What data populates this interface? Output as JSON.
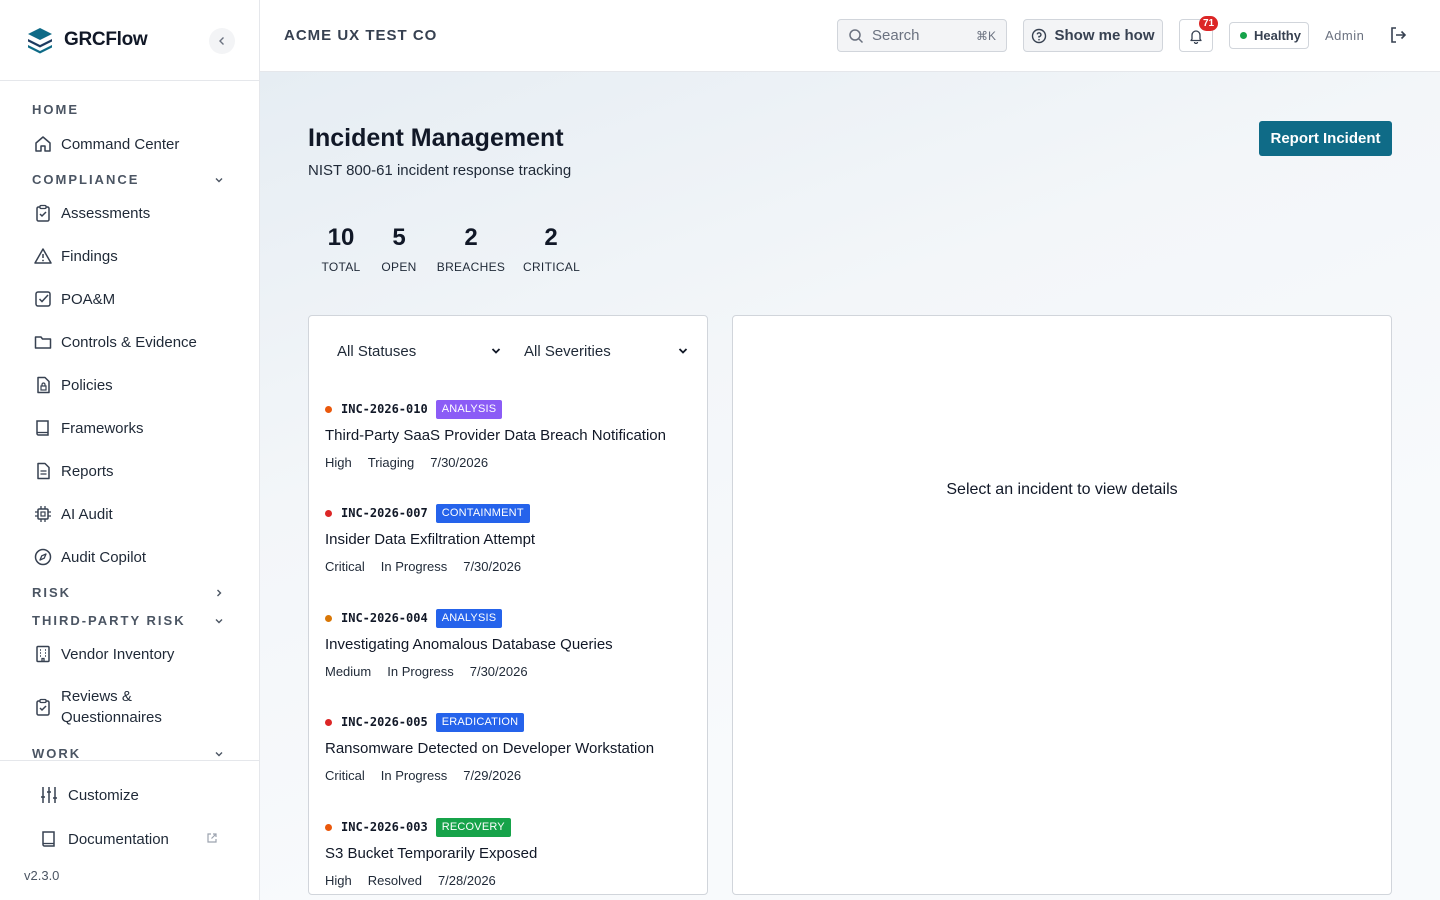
{
  "brand": {
    "name": "GRCFlow"
  },
  "sidebar": {
    "sections": {
      "home": "HOME",
      "compliance": "COMPLIANCE",
      "risk": "RISK",
      "third_party": "THIRD-PARTY RISK",
      "work": "WORK"
    },
    "items": {
      "command_center": "Command Center",
      "assessments": "Assessments",
      "findings": "Findings",
      "poam": "POA&M",
      "controls": "Controls & Evidence",
      "policies": "Policies",
      "frameworks": "Frameworks",
      "reports": "Reports",
      "ai_audit": "AI Audit",
      "audit_copilot": "Audit Copilot",
      "vendor_inventory": "Vendor Inventory",
      "reviews_line1": "Reviews &",
      "reviews_line2": "Questionnaires"
    },
    "footer": {
      "customize": "Customize",
      "documentation": "Documentation",
      "version": "v2.3.0"
    }
  },
  "topbar": {
    "org": "ACME UX TEST CO",
    "search_placeholder": "Search",
    "search_shortcut": "⌘K",
    "show_me_how": "Show me how",
    "notifications_count": "71",
    "health": "Healthy",
    "user": "Admin"
  },
  "page": {
    "title": "Incident Management",
    "subtitle": "NIST 800-61 incident response tracking",
    "report_button": "Report Incident"
  },
  "stats": [
    {
      "value": "10",
      "label": "TOTAL"
    },
    {
      "value": "5",
      "label": "OPEN"
    },
    {
      "value": "2",
      "label": "BREACHES"
    },
    {
      "value": "2",
      "label": "CRITICAL"
    }
  ],
  "filters": {
    "status": "All Statuses",
    "severity": "All Severities"
  },
  "incidents": [
    {
      "id": "INC-2026-010",
      "phase": "ANALYSIS",
      "phase_color": "#8b5cf6",
      "dot_color": "#ea580c",
      "title": "Third-Party SaaS Provider Data Breach Notification",
      "severity": "High",
      "status": "Triaging",
      "date": "7/30/2026"
    },
    {
      "id": "INC-2026-007",
      "phase": "CONTAINMENT",
      "phase_color": "#2563eb",
      "dot_color": "#dc2626",
      "title": "Insider Data Exfiltration Attempt",
      "severity": "Critical",
      "status": "In Progress",
      "date": "7/30/2026"
    },
    {
      "id": "INC-2026-004",
      "phase": "ANALYSIS",
      "phase_color": "#2563eb",
      "dot_color": "#d97706",
      "title": "Investigating Anomalous Database Queries",
      "severity": "Medium",
      "status": "In Progress",
      "date": "7/30/2026"
    },
    {
      "id": "INC-2026-005",
      "phase": "ERADICATION",
      "phase_color": "#2563eb",
      "dot_color": "#dc2626",
      "title": "Ransomware Detected on Developer Workstation",
      "severity": "Critical",
      "status": "In Progress",
      "date": "7/29/2026"
    },
    {
      "id": "INC-2026-003",
      "phase": "RECOVERY",
      "phase_color": "#16a34a",
      "dot_color": "#ea580c",
      "title": "S3 Bucket Temporarily Exposed",
      "severity": "High",
      "status": "Resolved",
      "date": "7/28/2026"
    }
  ],
  "detail": {
    "empty_message": "Select an incident to view details"
  }
}
